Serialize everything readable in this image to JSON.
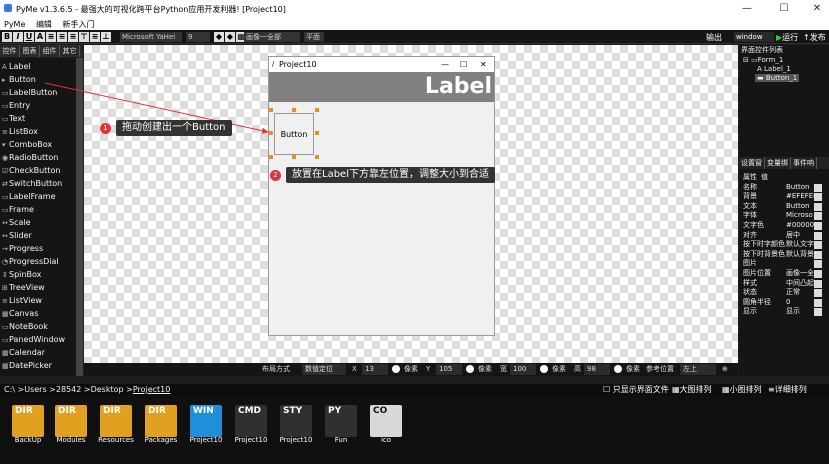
{
  "window": {
    "title": "PyMe v1.3.6.5 - 最强大的可视化跨平台Python应用开发利器!  [Project10]"
  },
  "menu": [
    "PyMe",
    "编辑",
    "新手入门"
  ],
  "toolbar": {
    "bold": "B",
    "italic": "I",
    "underline": "U",
    "strike": "A",
    "font": "Microsoft YaHei",
    "font_size": "9",
    "image_select": "画像一全部",
    "plane": "平面",
    "output": "输出",
    "window_select": "window",
    "run": "运行",
    "publish": "发布"
  },
  "left_tabs": [
    "控件",
    "图表",
    "组件",
    "其它"
  ],
  "components": [
    {
      "icon": "A",
      "label": "Label"
    },
    {
      "icon": "▸",
      "label": "Button"
    },
    {
      "icon": "▭",
      "label": "LabelButton"
    },
    {
      "icon": "▭",
      "label": "Entry"
    },
    {
      "icon": "▭",
      "label": "Text"
    },
    {
      "icon": "≡",
      "label": "ListBox"
    },
    {
      "icon": "▾",
      "label": "ComboBox"
    },
    {
      "icon": "◉",
      "label": "RadioButton"
    },
    {
      "icon": "☑",
      "label": "CheckButton"
    },
    {
      "icon": "⇄",
      "label": "SwitchButton"
    },
    {
      "icon": "▭",
      "label": "LabelFrame"
    },
    {
      "icon": "▭",
      "label": "Frame"
    },
    {
      "icon": "↔",
      "label": "Scale"
    },
    {
      "icon": "↔",
      "label": "Slider"
    },
    {
      "icon": "→",
      "label": "Progress"
    },
    {
      "icon": "◔",
      "label": "ProgressDial"
    },
    {
      "icon": "⇕",
      "label": "SpinBox"
    },
    {
      "icon": "⊞",
      "label": "TreeView"
    },
    {
      "icon": "≡",
      "label": "ListView"
    },
    {
      "icon": "▦",
      "label": "Canvas"
    },
    {
      "icon": "▭",
      "label": "NoteBook"
    },
    {
      "icon": "▭",
      "label": "PanedWindow"
    },
    {
      "icon": "▦",
      "label": "Calendar"
    },
    {
      "icon": "▦",
      "label": "DatePicker"
    }
  ],
  "form": {
    "title": "Project10",
    "label_text": "Label",
    "button_text": "Button"
  },
  "callouts": [
    {
      "num": "1",
      "text": "拖动创建出一个Button"
    },
    {
      "num": "2",
      "text": "放置在Label下方靠左位置，调整大小到合适"
    }
  ],
  "right_panel": {
    "title": "界面控件列表",
    "tree": [
      "Form_1",
      "Label_1",
      "Button_1"
    ],
    "prop_tabs": [
      "设置窗",
      "变量绑",
      "事件响"
    ],
    "prop_header": {
      "key": "属性",
      "value": "值"
    },
    "props": [
      {
        "k": "名称",
        "v": "Button"
      },
      {
        "k": "背景",
        "v": "#EFEFEF"
      },
      {
        "k": "文本",
        "v": "Button"
      },
      {
        "k": "字体",
        "v": "Microso"
      },
      {
        "k": "文字色",
        "v": "#000000"
      },
      {
        "k": "对齐",
        "v": "居中"
      },
      {
        "k": "按下时字颜色",
        "v": "默认文字"
      },
      {
        "k": "按下时背景色",
        "v": "默认背景"
      },
      {
        "k": "图片",
        "v": ""
      },
      {
        "k": "图片位置",
        "v": "画像一全"
      },
      {
        "k": "样式",
        "v": "中间凸起"
      },
      {
        "k": "状态",
        "v": "正常"
      },
      {
        "k": "圆角半径",
        "v": "0"
      },
      {
        "k": "显示",
        "v": "显示"
      }
    ]
  },
  "position_bar": {
    "layout_label": "布局方式",
    "layout_value": "数值定位",
    "x_label": "X",
    "x_value": "13",
    "y_label": "Y",
    "y_value": "105",
    "w_label": "宽",
    "w_value": "100",
    "h_label": "高",
    "h_value": "98",
    "unit": "像素",
    "ref_label": "参考位置",
    "ref_value": "左上"
  },
  "path": {
    "prefix": "C:\\ >Users >28542 >Desktop >",
    "current": "Project10"
  },
  "file_options": {
    "only_ui": "只显示界面文件",
    "large": "大图排列",
    "small": "小图排列",
    "detail": "详细排列"
  },
  "files": [
    {
      "type": "DIR",
      "name": "BackUp",
      "color": "#e0a020"
    },
    {
      "type": "DIR",
      "name": "Modules",
      "color": "#e0a020"
    },
    {
      "type": "DIR",
      "name": "Resources",
      "color": "#e0a020"
    },
    {
      "type": "DIR",
      "name": "Packages",
      "color": "#e0a020"
    },
    {
      "type": "WIN",
      "name": "Project10",
      "color": "#1e8fd8"
    },
    {
      "type": "CMD",
      "name": "Project10",
      "color": "#303030"
    },
    {
      "type": "STY",
      "name": "Project10",
      "color": "#303030"
    },
    {
      "type": "PY",
      "name": "Fun",
      "color": "#303030"
    },
    {
      "type": "CO",
      "name": "ico",
      "color": "#d8d8d8"
    }
  ]
}
